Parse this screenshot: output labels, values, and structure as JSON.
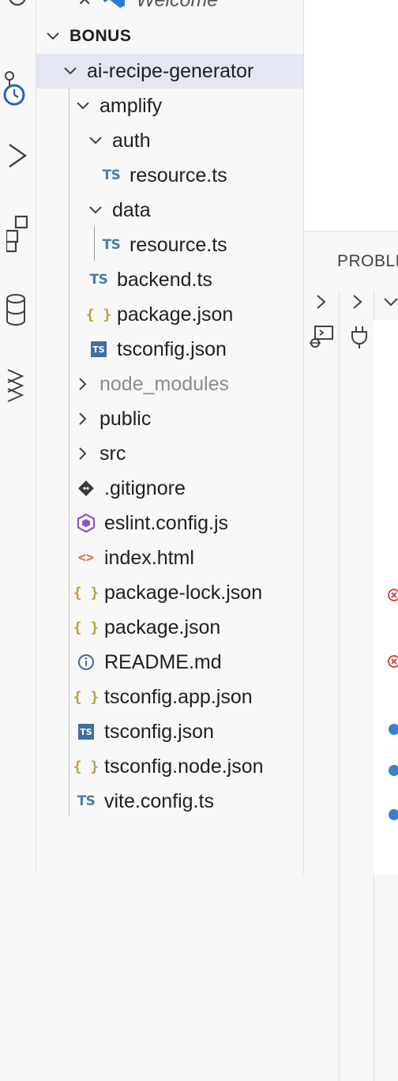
{
  "explorer": {
    "open_editor_item": "Welcome",
    "section_title": "BONUS",
    "tree": [
      {
        "label": "ai-recipe-generator",
        "kind": "folder",
        "expanded": true,
        "selected": true
      },
      {
        "label": "amplify",
        "kind": "folder",
        "expanded": true
      },
      {
        "label": "auth",
        "kind": "folder",
        "expanded": true
      },
      {
        "label": "resource.ts",
        "kind": "file",
        "icon": "ts"
      },
      {
        "label": "data",
        "kind": "folder",
        "expanded": true
      },
      {
        "label": "resource.ts",
        "kind": "file",
        "icon": "ts"
      },
      {
        "label": "backend.ts",
        "kind": "file",
        "icon": "ts"
      },
      {
        "label": "package.json",
        "kind": "file",
        "icon": "json"
      },
      {
        "label": "tsconfig.json",
        "kind": "file",
        "icon": "tsconfig"
      },
      {
        "label": "node_modules",
        "kind": "folder",
        "expanded": false,
        "dimmed": true
      },
      {
        "label": "public",
        "kind": "folder",
        "expanded": false
      },
      {
        "label": "src",
        "kind": "folder",
        "expanded": false
      },
      {
        "label": ".gitignore",
        "kind": "file",
        "icon": "git"
      },
      {
        "label": "eslint.config.js",
        "kind": "file",
        "icon": "eslint"
      },
      {
        "label": "index.html",
        "kind": "file",
        "icon": "html"
      },
      {
        "label": "package-lock.json",
        "kind": "file",
        "icon": "json"
      },
      {
        "label": "package.json",
        "kind": "file",
        "icon": "json"
      },
      {
        "label": "README.md",
        "kind": "file",
        "icon": "info"
      },
      {
        "label": "tsconfig.app.json",
        "kind": "file",
        "icon": "json"
      },
      {
        "label": "tsconfig.json",
        "kind": "file",
        "icon": "tsconfig"
      },
      {
        "label": "tsconfig.node.json",
        "kind": "file",
        "icon": "json"
      },
      {
        "label": "vite.config.ts",
        "kind": "file",
        "icon": "ts"
      }
    ]
  },
  "icons": {
    "ts_label": "TS",
    "json_label": "{ }",
    "html_label": "<>",
    "tsconfig_label": "TS"
  },
  "panel": {
    "tab_label": "PROBLE"
  },
  "colors": {
    "selected_row": "#e4e6f1",
    "ts_blue": "#4a7ea8",
    "json_yellow": "#b8a03a",
    "html_orange": "#d2703a",
    "eslint_purple": "#8a55c4",
    "error_red": "#d44b4b",
    "info_blue": "#3a7fd0"
  }
}
